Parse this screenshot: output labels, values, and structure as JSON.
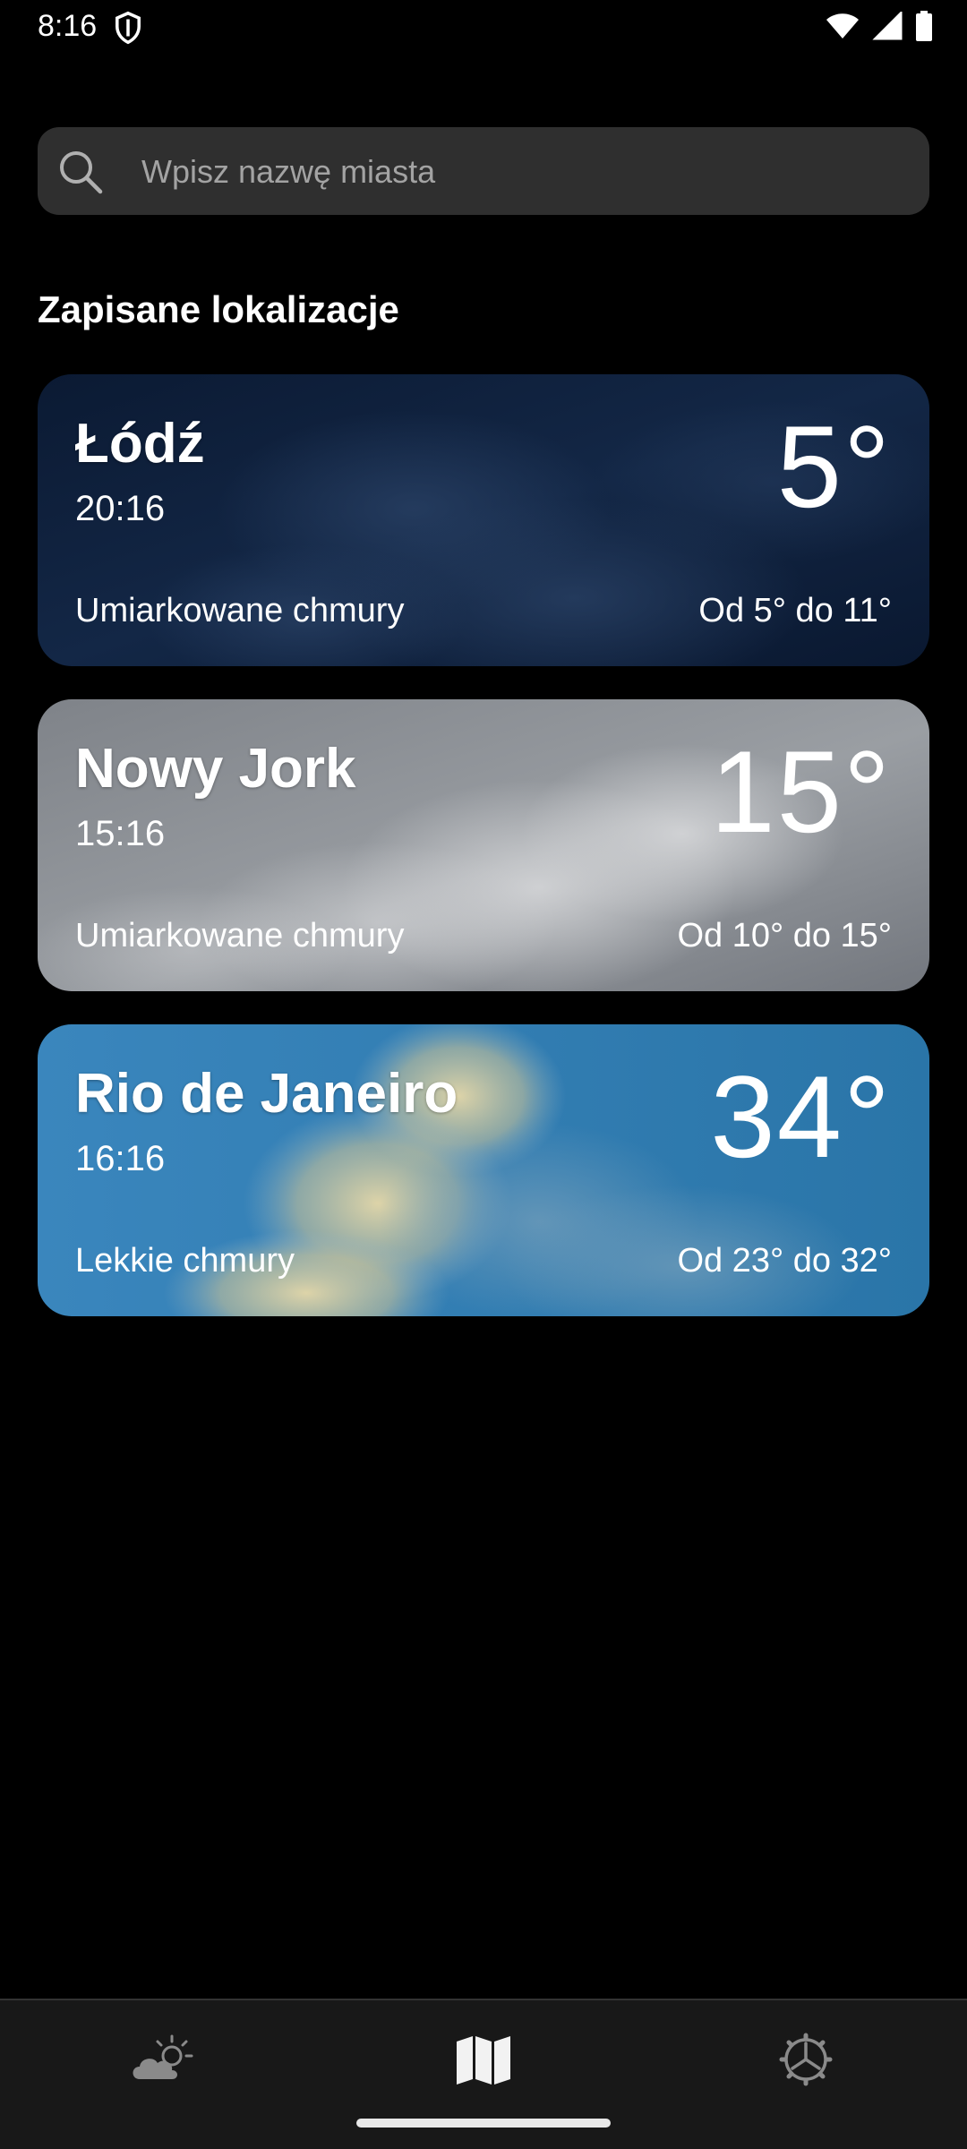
{
  "status_bar": {
    "time": "8:16",
    "icons": [
      "shield-icon",
      "wifi-icon",
      "signal-icon",
      "battery-icon"
    ]
  },
  "search": {
    "placeholder": "Wpisz nazwę miasta",
    "value": ""
  },
  "saved_section": {
    "title": "Zapisane lokalizacje"
  },
  "locations": [
    {
      "city": "Łódź",
      "time": "20:16",
      "temperature": "5°",
      "description": "Umiarkowane chmury",
      "range": "Od 5° do 11°",
      "theme": "night-clouds",
      "accent": "#0f1f3a"
    },
    {
      "city": "Nowy Jork",
      "time": "15:16",
      "temperature": "15°",
      "description": "Umiarkowane chmury",
      "range": "Od 10° do 15°",
      "theme": "grey-clouds",
      "accent": "#8a8e94"
    },
    {
      "city": "Rio de Janeiro",
      "time": "16:16",
      "temperature": "34°",
      "description": "Lekkie chmury",
      "range": "Od 23° do 32°",
      "theme": "day-clouds",
      "accent": "#2f7fb0"
    }
  ],
  "bottom_nav": {
    "items": [
      {
        "icon": "partly-cloudy-icon",
        "active": false
      },
      {
        "icon": "map-icon",
        "active": true
      },
      {
        "icon": "settings-gear-icon",
        "active": false
      }
    ]
  }
}
